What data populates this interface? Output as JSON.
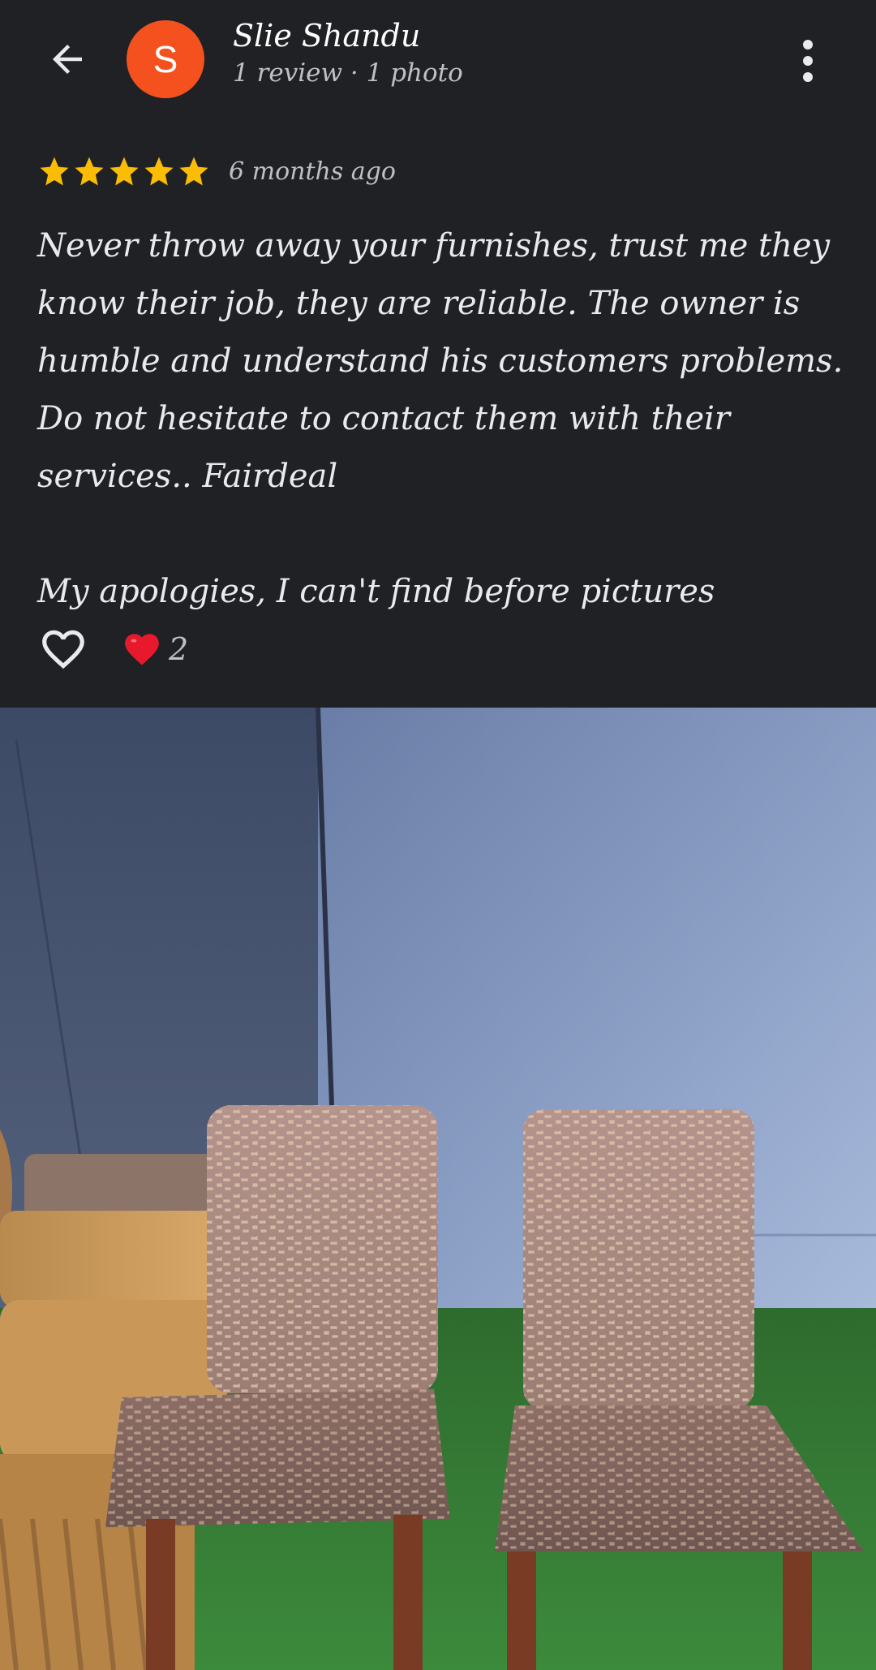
{
  "header": {
    "back_icon": "arrow-left-icon",
    "avatar_letter": "S",
    "avatar_color": "#f4511e",
    "user_name": "Slie Shandu",
    "user_meta": "1 review · 1 photo",
    "more_icon": "more-vertical-icon"
  },
  "review": {
    "rating": 5,
    "max_rating": 5,
    "star_color": "#fbbc04",
    "date": "6 months ago",
    "paragraphs": [
      "Never throw away your furnishes, trust me they know their job, they are reliable. The owner is humble and understand his customers problems. Do not hesitate to contact them with their services.. Fairdeal",
      "My apologies, I can't find before pictures"
    ]
  },
  "reactions": {
    "like_icon": "heart-outline-icon",
    "reaction_icon": "red-heart-icon",
    "count": "2"
  },
  "photo": {
    "description_icon": "review-photo"
  }
}
